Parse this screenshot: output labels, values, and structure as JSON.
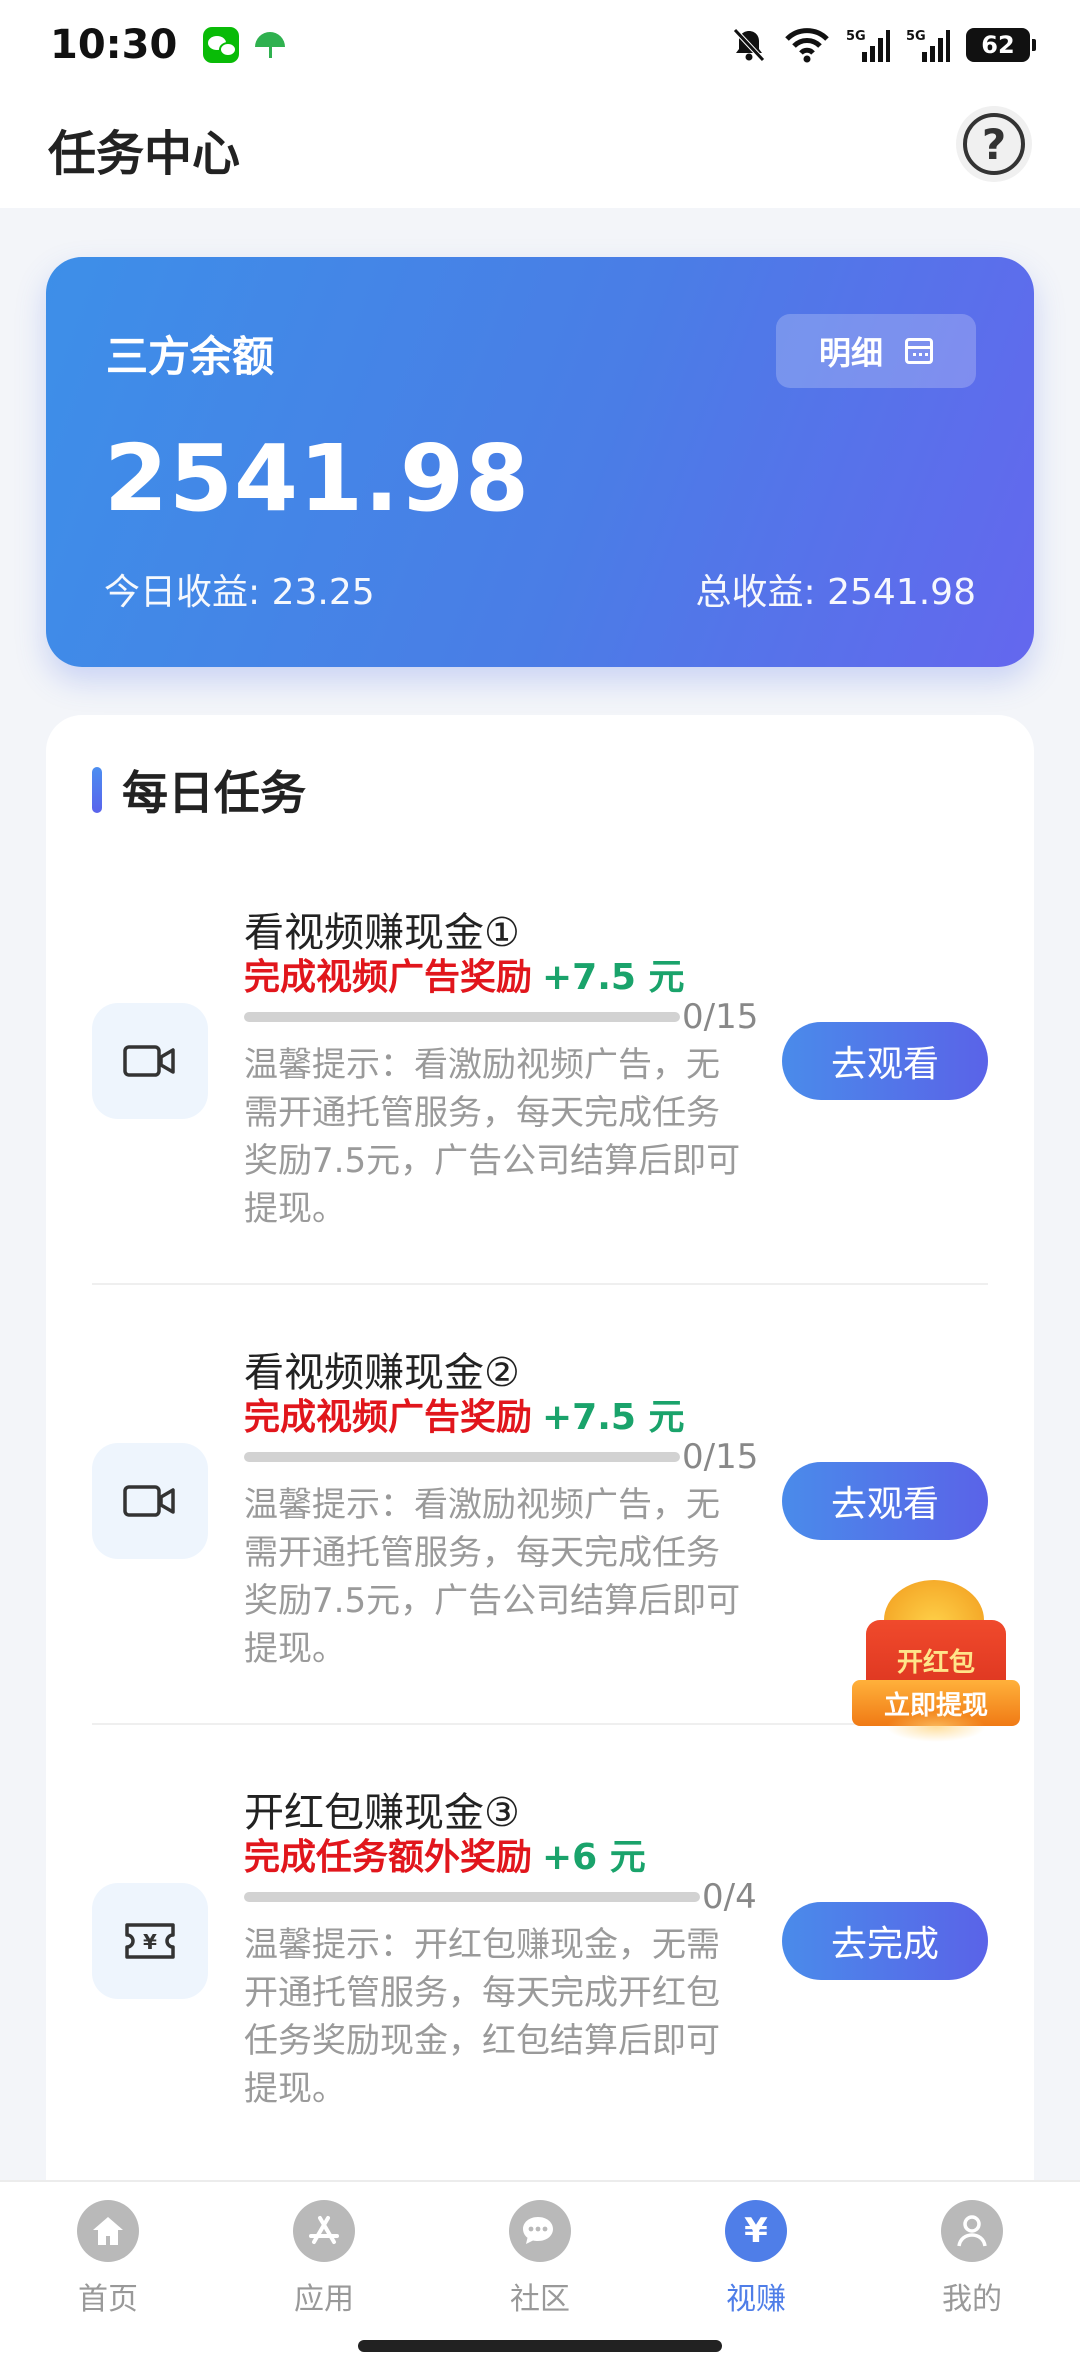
{
  "status_bar": {
    "time": "10:30",
    "battery": "62",
    "network_1": "5G",
    "network_2": "5G"
  },
  "header": {
    "title": "任务中心",
    "help_icon": "?"
  },
  "balance": {
    "label": "三方余额",
    "detail_button": "明细",
    "amount": "2541.98",
    "today": "今日收益: 23.25",
    "total": "总收益: 2541.98"
  },
  "daily_tasks": {
    "title": "每日任务",
    "tasks": [
      {
        "title": "看视频赚现金①",
        "reward_label": "完成视频广告奖励",
        "reward_amount": "+7.5 元",
        "progress_text": "0/15",
        "progress": 0,
        "desc": "温馨提示：看激励视频广告，无需开通托管服务，每天完成任务奖励7.5元，广告公司结算后即可提现。",
        "button": "去观看",
        "icon": "video-camera-icon"
      },
      {
        "title": "看视频赚现金②",
        "reward_label": "完成视频广告奖励",
        "reward_amount": "+7.5 元",
        "progress_text": "0/15",
        "progress": 0,
        "desc": "温馨提示：看激励视频广告，无需开通托管服务，每天完成任务奖励7.5元，广告公司结算后即可提现。",
        "button": "去观看",
        "icon": "video-camera-icon"
      },
      {
        "title": "开红包赚现金③",
        "reward_label": "完成任务额外奖励",
        "reward_amount": "+6 元",
        "progress_text": "0/4",
        "progress": 0,
        "desc": "温馨提示：开红包赚现金，无需开通托管服务，每天完成开红包任务奖励现金，红包结算后即可提现。",
        "button": "去完成",
        "icon": "ticket-yuan-icon"
      }
    ]
  },
  "red_packet": {
    "top": "开红包",
    "bottom": "立即提现",
    "coin_symbol": "$"
  },
  "nav": {
    "items": [
      {
        "label": "首页",
        "icon": "home-icon",
        "active": false
      },
      {
        "label": "应用",
        "icon": "app-store-icon",
        "active": false
      },
      {
        "label": "社区",
        "icon": "chat-icon",
        "active": false
      },
      {
        "label": "视赚",
        "icon": "yen-icon",
        "active": true
      },
      {
        "label": "我的",
        "icon": "profile-icon",
        "active": false
      }
    ],
    "yen_glyph": "¥"
  },
  "colors": {
    "accent": "#4f7ee8",
    "reward_red": "#e1161c",
    "reward_green": "#1aa36b"
  }
}
